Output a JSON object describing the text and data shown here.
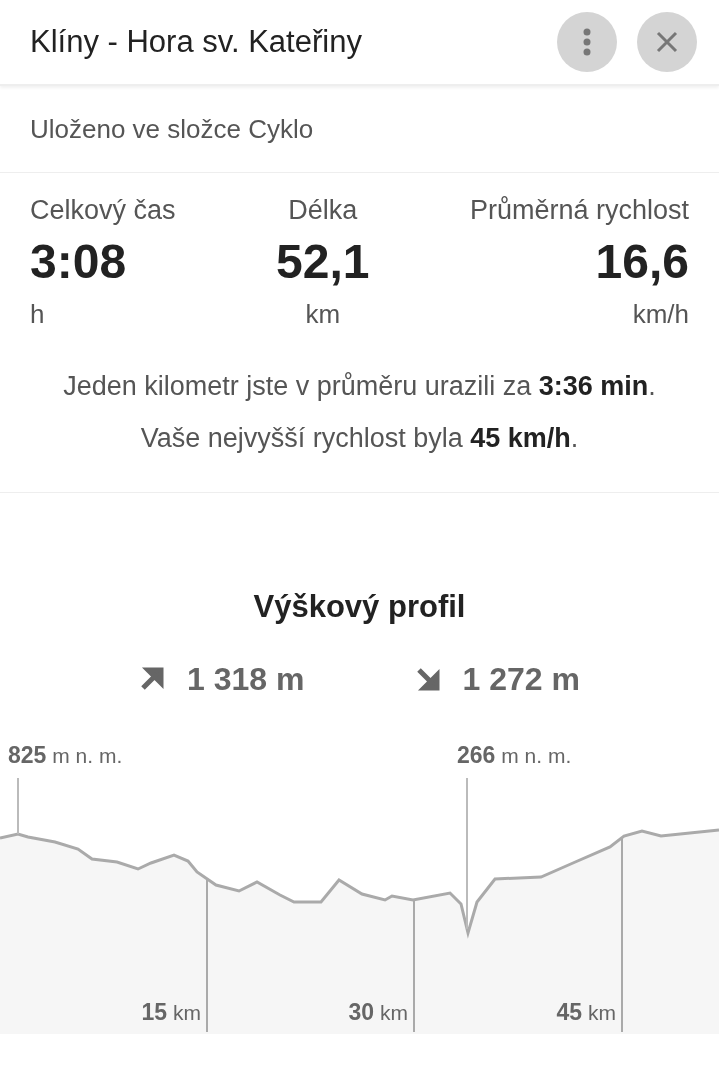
{
  "header": {
    "title": "Klíny - Hora sv. Kateřiny"
  },
  "folder": "Uloženo ve složce Cyklo",
  "stats": [
    {
      "label": "Celkový čas",
      "value": "3:08",
      "unit": "h"
    },
    {
      "label": "Délka",
      "value": "52,1",
      "unit": "km"
    },
    {
      "label": "Průměrná rychlost",
      "value": "16,6",
      "unit": "km/h"
    }
  ],
  "summary": [
    "Jeden kilometr jste v průměru urazili za **3:36 min**.",
    "Vaše nejvyšší rychlost byla **45 km/h**."
  ],
  "profile": {
    "title": "Výškový profil",
    "ascent": "1 318 m",
    "descent": "1 272 m",
    "markers": [
      {
        "value": "825",
        "unit": "m n. m."
      },
      {
        "value": "266",
        "unit": "m n. m."
      }
    ],
    "distances": [
      {
        "value": "15",
        "unit": "km"
      },
      {
        "value": "30",
        "unit": "km"
      },
      {
        "value": "45",
        "unit": "km"
      }
    ]
  }
}
